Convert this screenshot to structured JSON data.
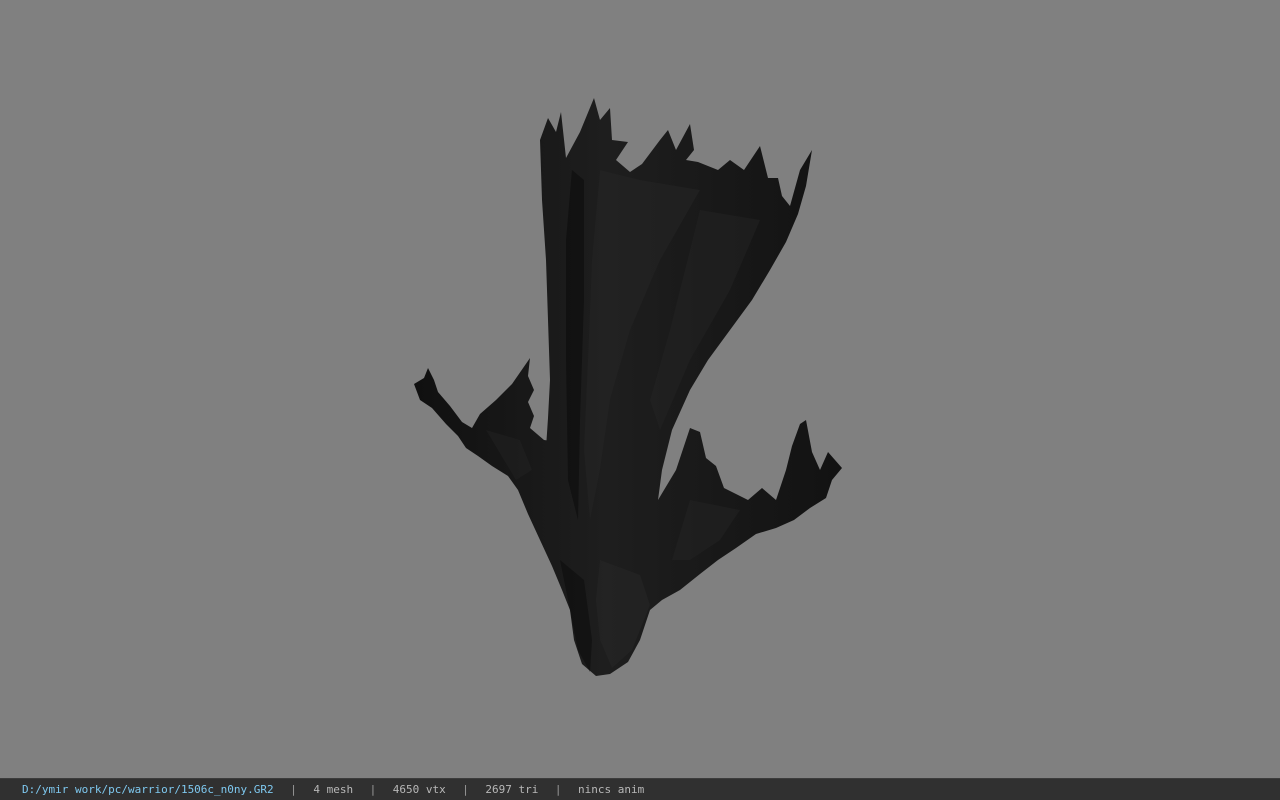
{
  "viewport": {
    "background_color": "#808080",
    "model_color": "#161616",
    "model_shade_color": "#262626"
  },
  "status_bar": {
    "file_path": "D:/ymir work/pc/warrior/1506c_n0ny.GR2",
    "separator": "|",
    "mesh_count": "4 mesh",
    "vertex_count": "4650 vtx",
    "triangle_count": "2697 tri",
    "anim_status": "nincs anim",
    "path_color": "#7ec8ef",
    "text_color": "#b8b8b8"
  }
}
